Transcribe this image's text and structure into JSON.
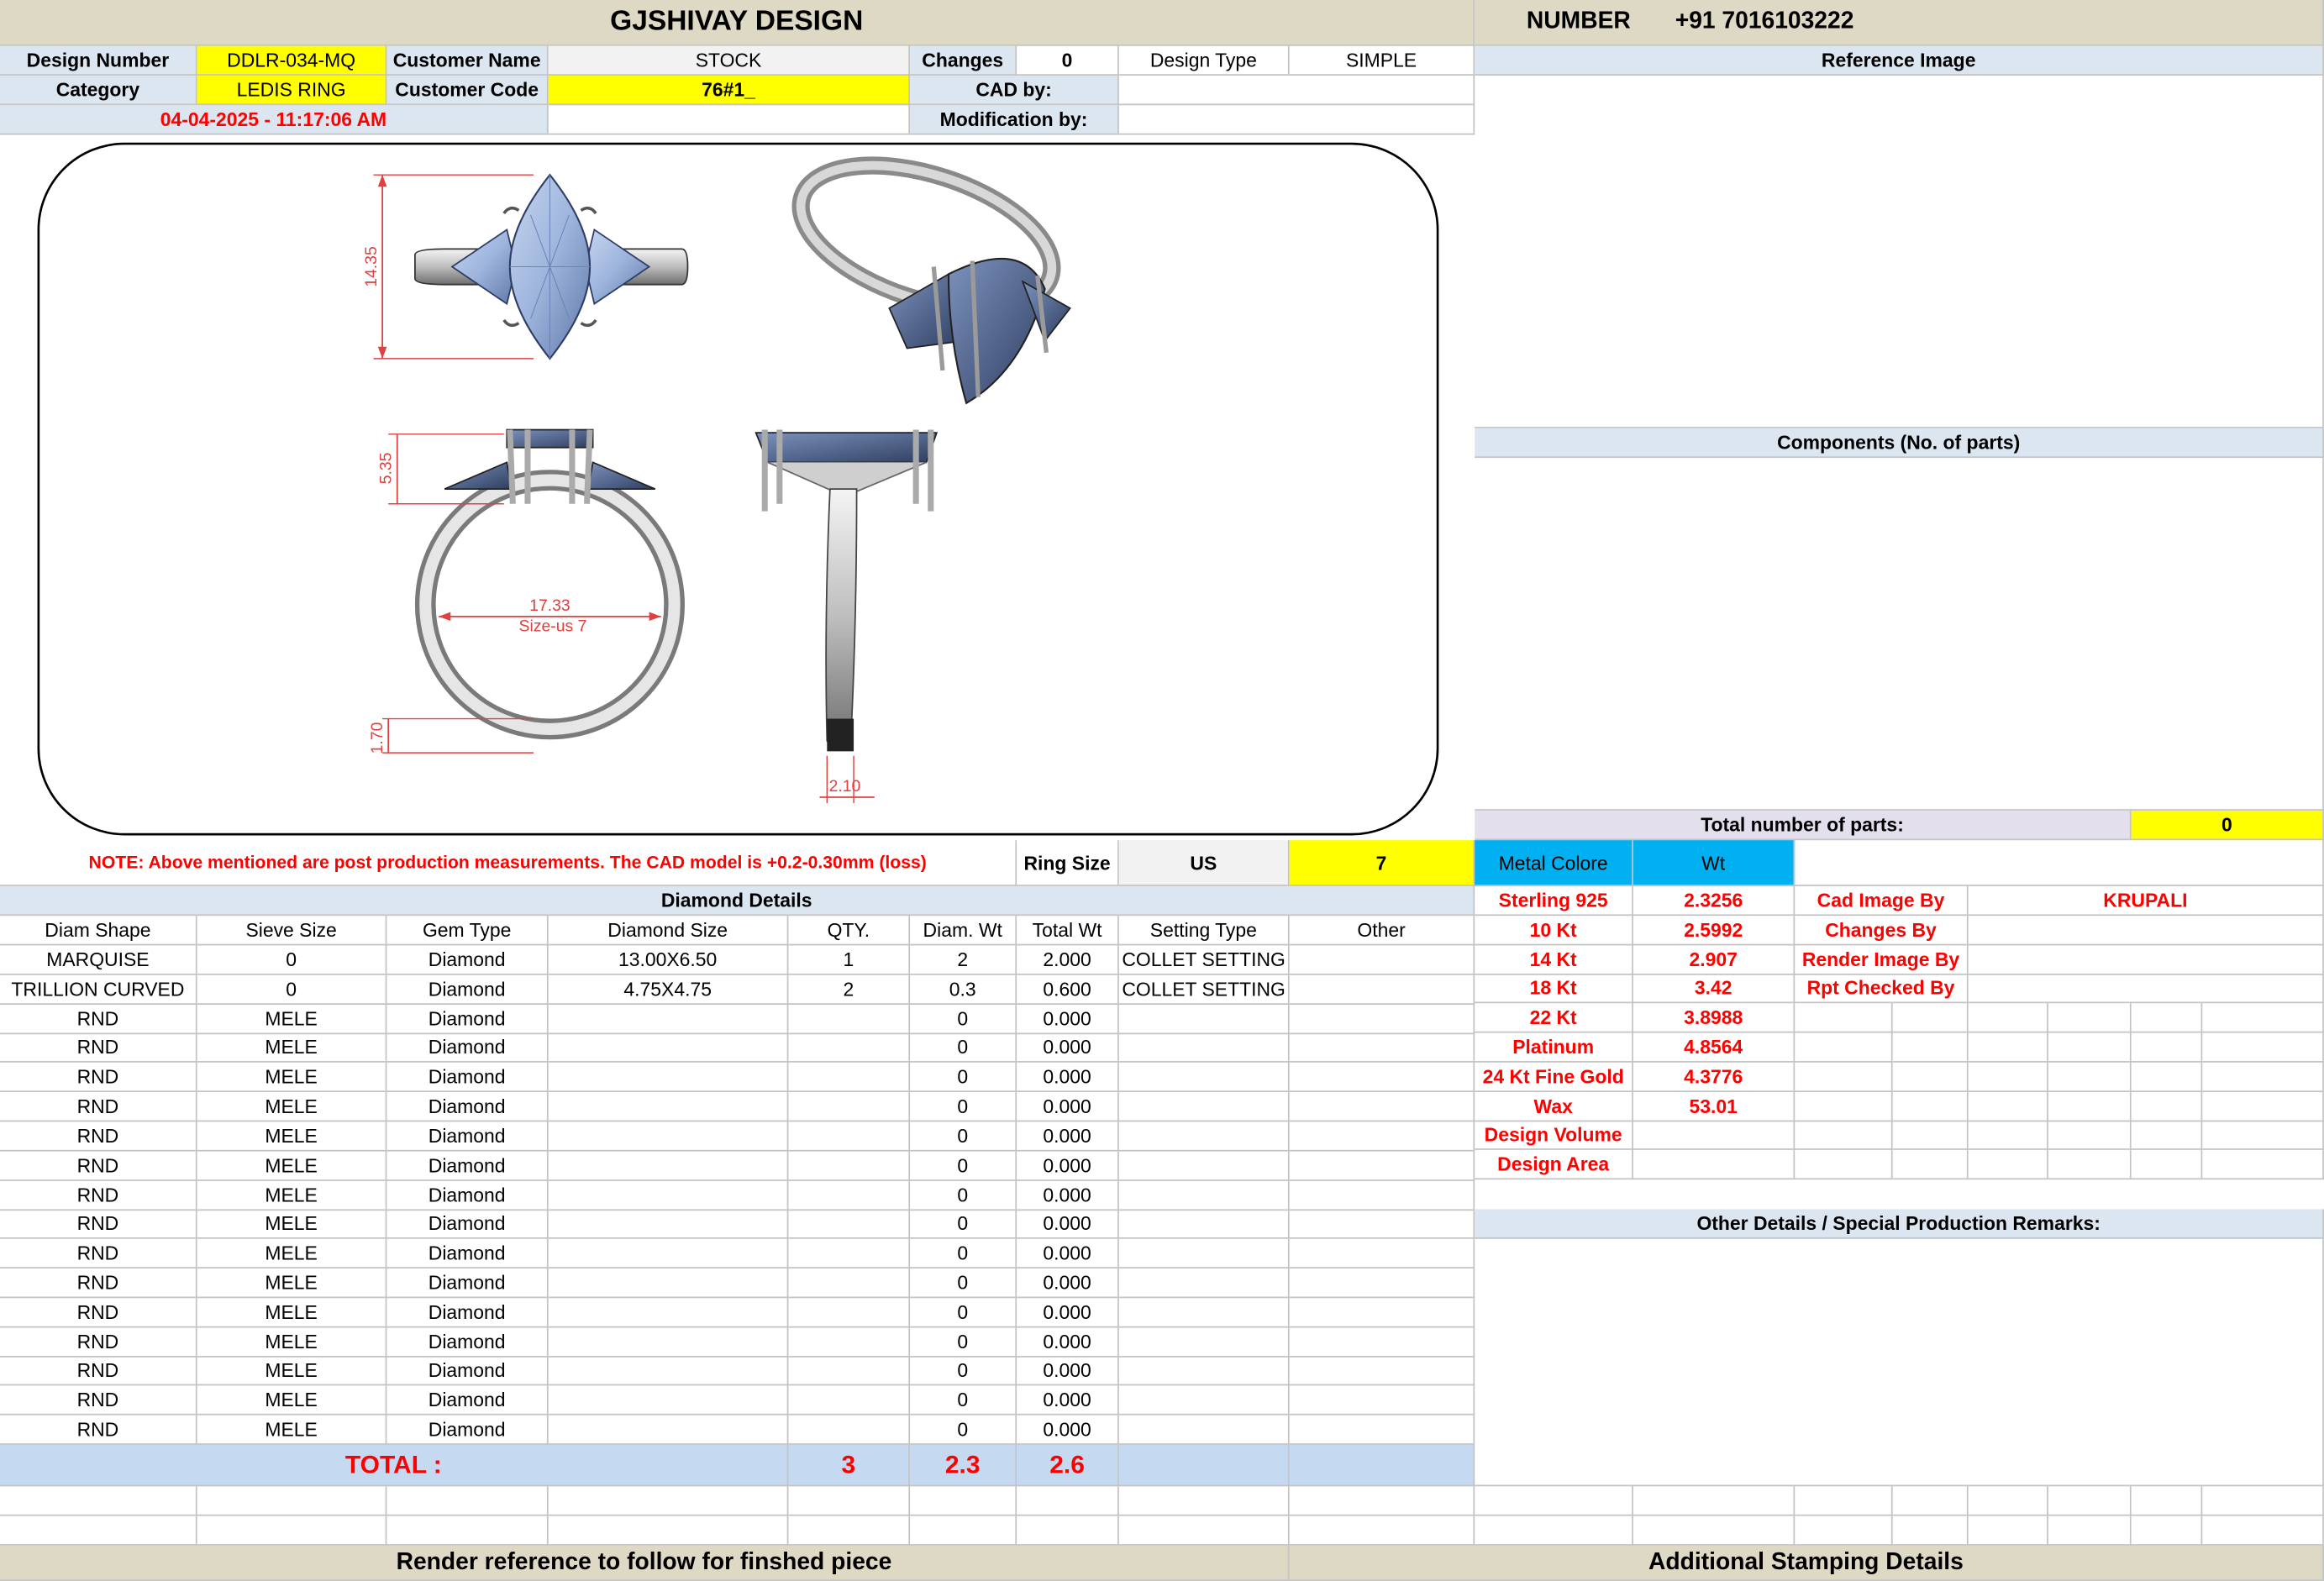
{
  "header": {
    "company": "GJSHIVAY DESIGN",
    "number_label": "NUMBER",
    "phone": "+91 7016103222"
  },
  "info": {
    "design_number_label": "Design Number",
    "design_number": "DDLR-034-MQ",
    "customer_name_label": "Customer Name",
    "customer_name": "STOCK",
    "changes_label": "Changes",
    "changes": "0",
    "design_type_label": "Design Type",
    "design_type": "SIMPLE",
    "category_label": "Category",
    "category": "LEDIS RING",
    "customer_code_label": "Customer Code",
    "customer_code": "76#1_",
    "cad_by_label": "CAD by:",
    "cad_by": "",
    "timestamp": "04-04-2025 - 11:17:06 AM",
    "modification_label": "Modification by:",
    "modification_by": ""
  },
  "sections": {
    "reference_image": "Reference Image",
    "components": "Components (No. of parts)",
    "total_parts_label": "Total number of parts:",
    "total_parts": "0",
    "other_details": "Other Details / Special Production Remarks:",
    "render_reference": "Render reference to follow for finshed piece",
    "stamping": "Additional Stamping Details"
  },
  "drawing": {
    "dim_height": "14.35",
    "dim_head": "5.35",
    "dim_inner": "17.33",
    "size_label": "Size-us 7",
    "dim_band": "1.70",
    "dim_width": "2.10"
  },
  "note": "NOTE: Above mentioned are post production measurements. The CAD model is +0.2-0.30mm (loss)",
  "ring_size": {
    "label": "Ring Size",
    "unit": "US",
    "value": "7"
  },
  "metal": {
    "label": "Metal Colore",
    "wt_label": "Wt",
    "rows": [
      {
        "name": "Sterling 925",
        "wt": "2.3256"
      },
      {
        "name": "10 Kt",
        "wt": "2.5992"
      },
      {
        "name": "14 Kt",
        "wt": "2.907"
      },
      {
        "name": "18 Kt",
        "wt": "3.42"
      },
      {
        "name": "22 Kt",
        "wt": "3.8988"
      },
      {
        "name": "Platinum",
        "wt": "4.8564"
      },
      {
        "name": "24 Kt Fine Gold",
        "wt": "4.3776"
      },
      {
        "name": "Wax",
        "wt": "53.01"
      },
      {
        "name": "Design Volume",
        "wt": ""
      },
      {
        "name": "Design Area",
        "wt": ""
      }
    ]
  },
  "credits": [
    {
      "label": "Cad Image By",
      "value": "KRUPALI"
    },
    {
      "label": "Changes By",
      "value": ""
    },
    {
      "label": "Render Image By",
      "value": ""
    },
    {
      "label": "Rpt Checked By",
      "value": ""
    }
  ],
  "diamonds": {
    "title": "Diamond Details",
    "headers": [
      "Diam Shape",
      "Sieve Size",
      "Gem Type",
      "Diamond Size",
      "QTY.",
      "Diam. Wt",
      "Total Wt",
      "Setting Type",
      "Other"
    ],
    "rows": [
      [
        "MARQUISE",
        "0",
        "Diamond",
        "13.00X6.50",
        "1",
        "2",
        "2.000",
        "COLLET SETTING",
        ""
      ],
      [
        "TRILLION CURVED",
        "0",
        "Diamond",
        "4.75X4.75",
        "2",
        "0.3",
        "0.600",
        "COLLET SETTING",
        ""
      ],
      [
        "RND",
        "MELE",
        "Diamond",
        "",
        "",
        "0",
        "0.000",
        "",
        ""
      ],
      [
        "RND",
        "MELE",
        "Diamond",
        "",
        "",
        "0",
        "0.000",
        "",
        ""
      ],
      [
        "RND",
        "MELE",
        "Diamond",
        "",
        "",
        "0",
        "0.000",
        "",
        ""
      ],
      [
        "RND",
        "MELE",
        "Diamond",
        "",
        "",
        "0",
        "0.000",
        "",
        ""
      ],
      [
        "RND",
        "MELE",
        "Diamond",
        "",
        "",
        "0",
        "0.000",
        "",
        ""
      ],
      [
        "RND",
        "MELE",
        "Diamond",
        "",
        "",
        "0",
        "0.000",
        "",
        ""
      ],
      [
        "RND",
        "MELE",
        "Diamond",
        "",
        "",
        "0",
        "0.000",
        "",
        ""
      ],
      [
        "RND",
        "MELE",
        "Diamond",
        "",
        "",
        "0",
        "0.000",
        "",
        ""
      ],
      [
        "RND",
        "MELE",
        "Diamond",
        "",
        "",
        "0",
        "0.000",
        "",
        ""
      ],
      [
        "RND",
        "MELE",
        "Diamond",
        "",
        "",
        "0",
        "0.000",
        "",
        ""
      ],
      [
        "RND",
        "MELE",
        "Diamond",
        "",
        "",
        "0",
        "0.000",
        "",
        ""
      ],
      [
        "RND",
        "MELE",
        "Diamond",
        "",
        "",
        "0",
        "0.000",
        "",
        ""
      ],
      [
        "RND",
        "MELE",
        "Diamond",
        "",
        "",
        "0",
        "0.000",
        "",
        ""
      ],
      [
        "RND",
        "MELE",
        "Diamond",
        "",
        "",
        "0",
        "0.000",
        "",
        ""
      ],
      [
        "RND",
        "MELE",
        "Diamond",
        "",
        "",
        "0",
        "0.000",
        "",
        ""
      ]
    ],
    "total_label": "TOTAL :",
    "total_qty": "3",
    "total_diam_wt": "2.3",
    "total_wt": "2.6"
  },
  "colors": {
    "tan": "#ddd9c4",
    "blue": "#dce6f1",
    "yellow": "#ffff00",
    "teal": "#00b0f0",
    "red": "#ff0000",
    "stone": "#9db4dc"
  }
}
